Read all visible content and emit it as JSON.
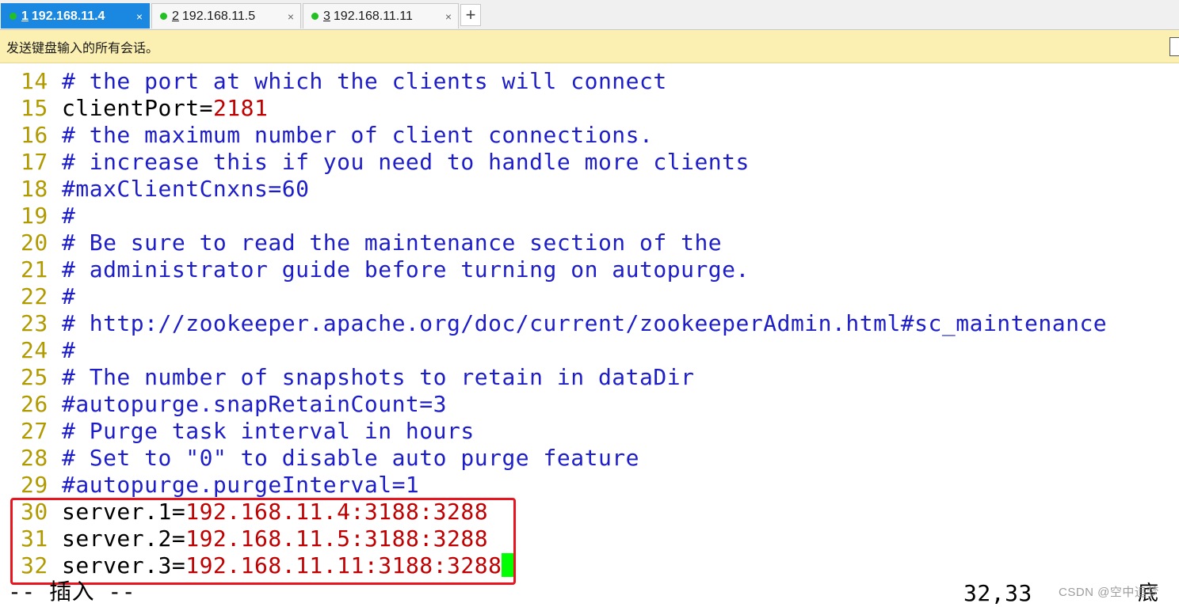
{
  "tabs": [
    {
      "number": "1",
      "label": "192.168.11.4",
      "active": true,
      "close": "×"
    },
    {
      "number": "2",
      "label": "192.168.11.5",
      "active": false,
      "close": "×"
    },
    {
      "number": "3",
      "label": "192.168.11.11",
      "active": false,
      "close": "×"
    }
  ],
  "add_tab_label": "+",
  "send_bar": {
    "text": "发送键盘输入的所有会话。"
  },
  "editor": {
    "lines": [
      {
        "number": "14",
        "parts": [
          {
            "t": "# the port at which the clients will connect",
            "k": "comment"
          }
        ]
      },
      {
        "number": "15",
        "parts": [
          {
            "t": "clientPort=",
            "k": "key"
          },
          {
            "t": "2181",
            "k": "val"
          }
        ]
      },
      {
        "number": "16",
        "parts": [
          {
            "t": "# the maximum number of client connections.",
            "k": "comment"
          }
        ]
      },
      {
        "number": "17",
        "parts": [
          {
            "t": "# increase this if you need to handle more clients",
            "k": "comment"
          }
        ]
      },
      {
        "number": "18",
        "parts": [
          {
            "t": "#maxClientCnxns=60",
            "k": "comment"
          }
        ]
      },
      {
        "number": "19",
        "parts": [
          {
            "t": "#",
            "k": "comment"
          }
        ]
      },
      {
        "number": "20",
        "parts": [
          {
            "t": "# Be sure to read the maintenance section of the",
            "k": "comment"
          }
        ]
      },
      {
        "number": "21",
        "parts": [
          {
            "t": "# administrator guide before turning on autopurge.",
            "k": "comment"
          }
        ]
      },
      {
        "number": "22",
        "parts": [
          {
            "t": "#",
            "k": "comment"
          }
        ]
      },
      {
        "number": "23",
        "parts": [
          {
            "t": "# http://zookeeper.apache.org/doc/current/zookeeperAdmin.html#sc_maintenance",
            "k": "comment"
          }
        ]
      },
      {
        "number": "24",
        "parts": [
          {
            "t": "#",
            "k": "comment"
          }
        ]
      },
      {
        "number": "25",
        "parts": [
          {
            "t": "# The number of snapshots to retain in dataDir",
            "k": "comment"
          }
        ]
      },
      {
        "number": "26",
        "parts": [
          {
            "t": "#autopurge.snapRetainCount=3",
            "k": "comment"
          }
        ]
      },
      {
        "number": "27",
        "parts": [
          {
            "t": "# Purge task interval in hours",
            "k": "comment"
          }
        ]
      },
      {
        "number": "28",
        "parts": [
          {
            "t": "# Set to \"0\" to disable auto purge feature",
            "k": "comment"
          }
        ]
      },
      {
        "number": "29",
        "parts": [
          {
            "t": "#autopurge.purgeInterval=1",
            "k": "comment"
          }
        ]
      },
      {
        "number": "30",
        "parts": [
          {
            "t": "server.1=",
            "k": "key"
          },
          {
            "t": "192.168.11.4:3188:3288",
            "k": "val"
          }
        ]
      },
      {
        "number": "31",
        "parts": [
          {
            "t": "server.2=",
            "k": "key"
          },
          {
            "t": "192.168.11.5:3188:3288",
            "k": "val"
          }
        ]
      },
      {
        "number": "32",
        "parts": [
          {
            "t": "server.3=",
            "k": "key"
          },
          {
            "t": "192.168.11.11:3188:3288",
            "k": "val"
          }
        ],
        "cursor": true
      }
    ]
  },
  "status": {
    "mode": "-- 插入 --",
    "position": "32,33",
    "scroll": "底端"
  },
  "watermark": "CSDN @空中追梦",
  "colors": {
    "comment": "#1e1ec8",
    "value": "#c00000",
    "line_number": "#b09a00",
    "cursor": "#00ff00",
    "highlight": "#e8141e",
    "active_tab": "#1a88e0",
    "send_bar": "#fbefb1"
  }
}
